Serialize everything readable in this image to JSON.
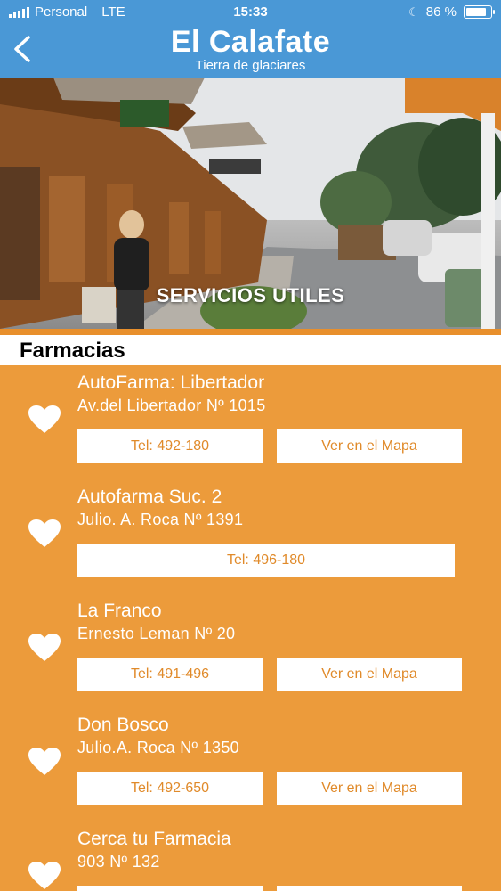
{
  "status_bar": {
    "carrier": "Personal",
    "network": "LTE",
    "time": "15:33",
    "battery": "86 %"
  },
  "header": {
    "title": "El Calafate",
    "subtitle": "Tierra de glaciares",
    "back_icon": "chevron-left-icon"
  },
  "hero": {
    "caption": "SERVICIOS UTILES"
  },
  "section": {
    "title": "Farmacias"
  },
  "colors": {
    "header_blue": "#4a98d6",
    "list_orange": "#ec9b3b",
    "divider_orange": "#e88f2c",
    "button_text": "#e08a2a"
  },
  "pharmacies": [
    {
      "name": "AutoFarma: Libertador",
      "address": "Av.del Libertador Nº 1015",
      "tel": "Tel: 492-180",
      "map": "Ver en el Mapa"
    },
    {
      "name": "Autofarma Suc. 2",
      "address": "Julio. A. Roca Nº  1391",
      "tel": "Tel: 496-180"
    },
    {
      "name": "La Franco",
      "address": "Ernesto Leman Nº 20",
      "tel": "Tel: 491-496",
      "map": "Ver en el Mapa"
    },
    {
      "name": "Don Bosco",
      "address": "Julio.A. Roca Nº 1350",
      "tel": "Tel: 492-650",
      "map": "Ver en el Mapa"
    },
    {
      "name": "Cerca tu Farmacia",
      "address": "903 Nº 132",
      "tel": "",
      "map": ""
    }
  ]
}
